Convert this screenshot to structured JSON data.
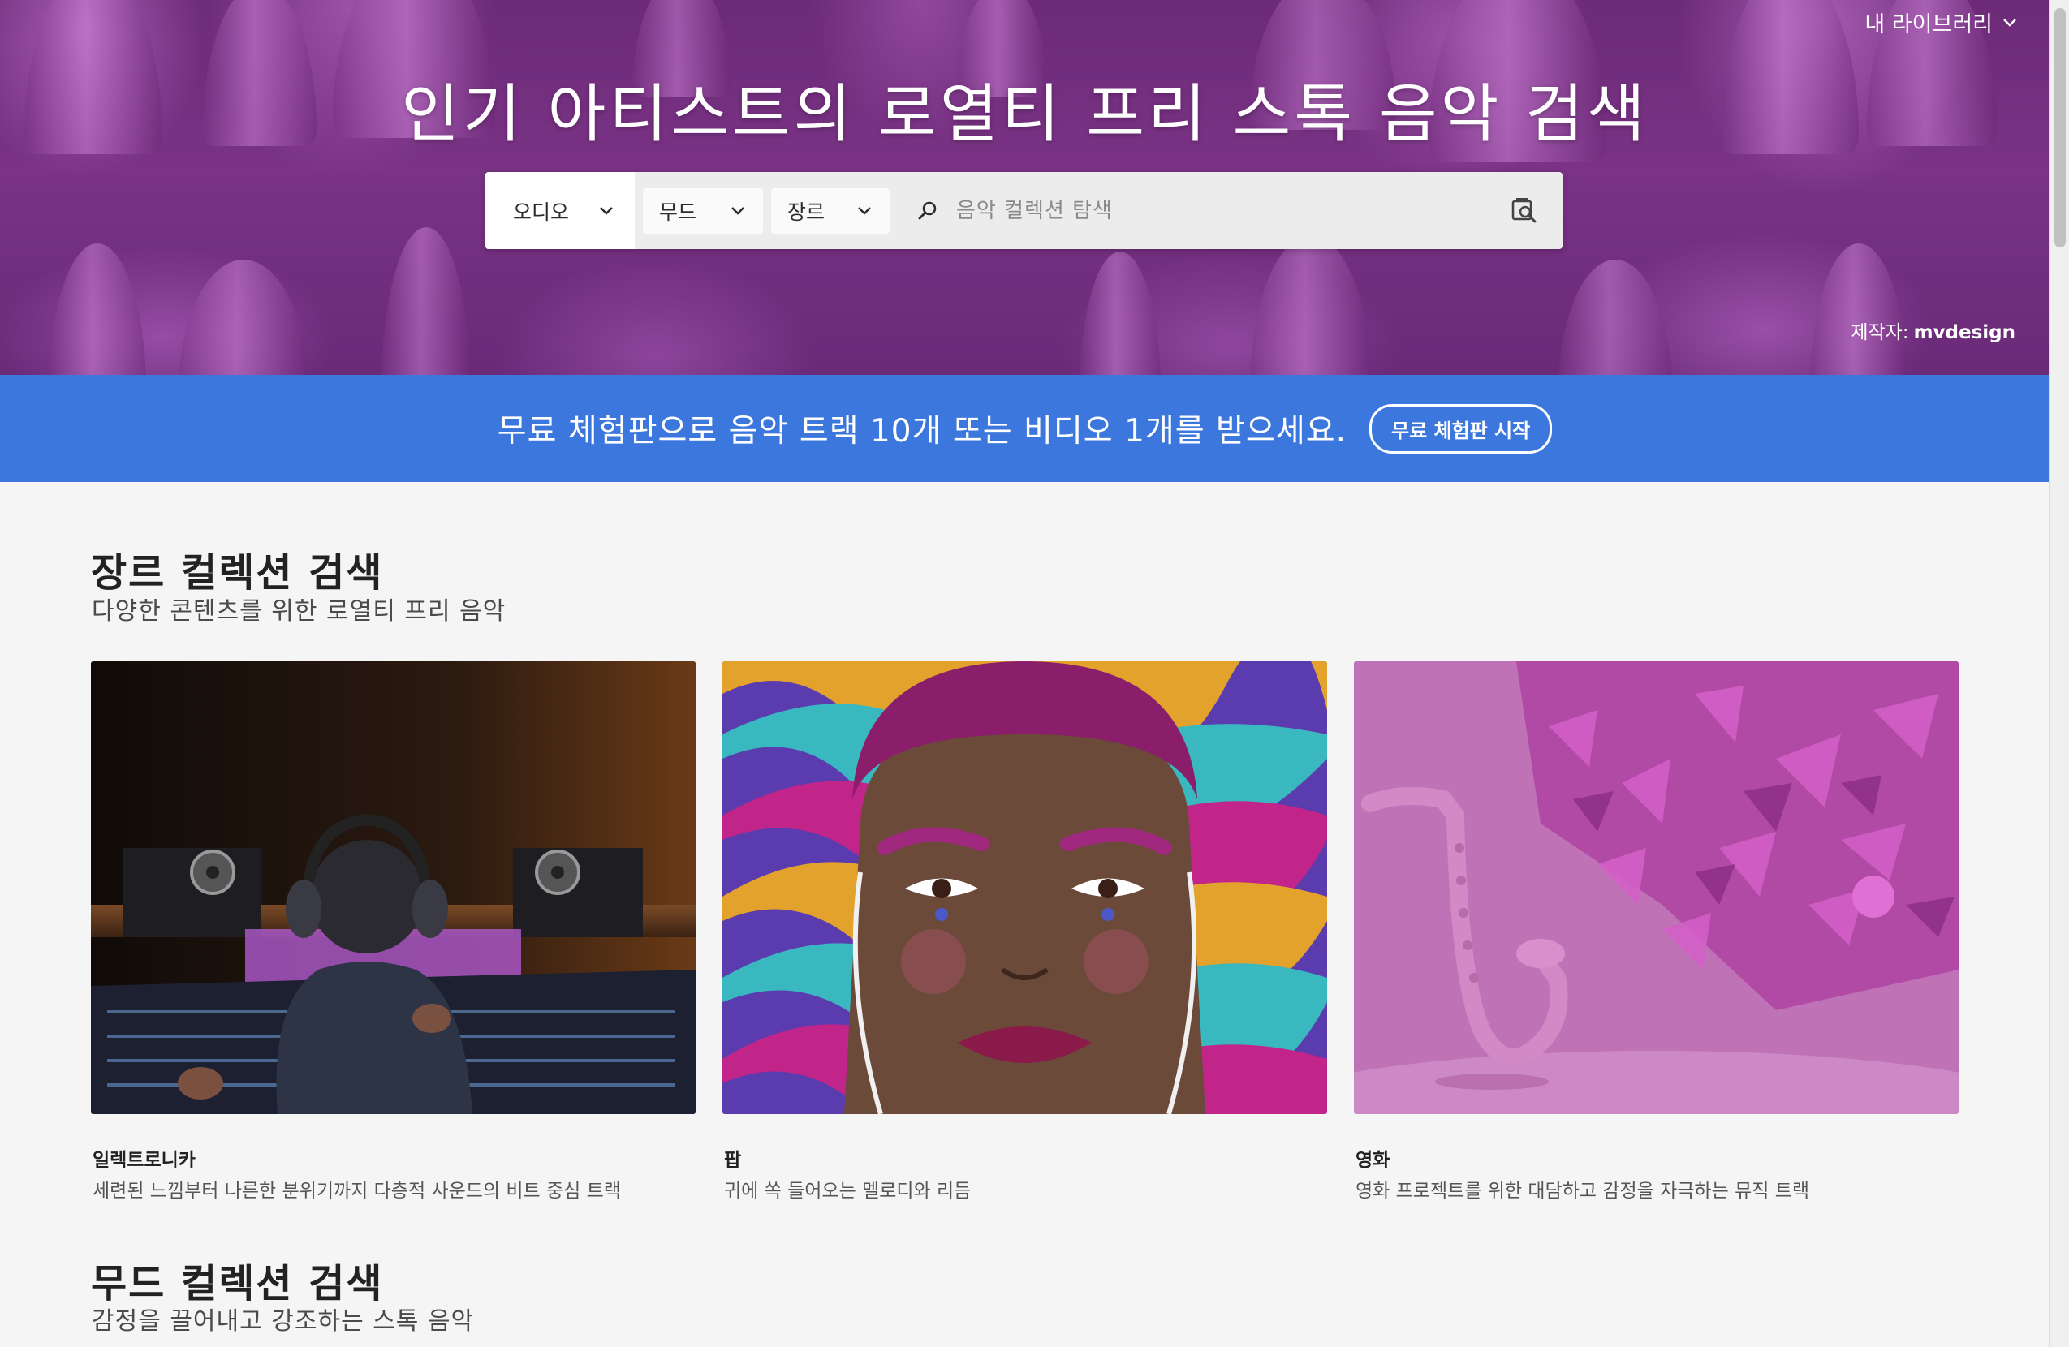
{
  "header": {
    "library_label": "내 라이브러리",
    "title": "인기 아티스트의 로열티 프리 스톡 음악 검색",
    "credit_prefix": "제작자:",
    "credit_name": "mvdesign"
  },
  "search": {
    "type_label": "오디오",
    "mood_label": "무드",
    "genre_label": "장르",
    "placeholder": "음악 컬렉션 탐색"
  },
  "promo": {
    "text": "무료 체험판으로 음악 트랙 10개 또는 비디오 1개를 받으세요.",
    "button": "무료 체험판 시작"
  },
  "genre_section": {
    "title": "장르 컬렉션 검색",
    "subtitle": "다양한 콘텐츠를 위한 로열티 프리 음악",
    "cards": [
      {
        "title": "일렉트로니카",
        "desc": "세련된 느낌부터 나른한 분위기까지 다층적 사운드의 비트 중심 트랙"
      },
      {
        "title": "팝",
        "desc": "귀에 쏙 들어오는 멜로디와 리듬"
      },
      {
        "title": "영화",
        "desc": "영화 프로젝트를 위한 대담하고 감정을 자극하는 뮤직 트랙"
      }
    ]
  },
  "mood_section": {
    "title": "무드 컬렉션 검색",
    "subtitle": "감정을 끌어내고 강조하는 스톡 음악"
  },
  "colors": {
    "hero": "#7a3385",
    "promo": "#3b77dc",
    "background": "#f5f5f5"
  },
  "icons": [
    "chevron-down-icon",
    "search-icon",
    "visual-search-icon"
  ]
}
